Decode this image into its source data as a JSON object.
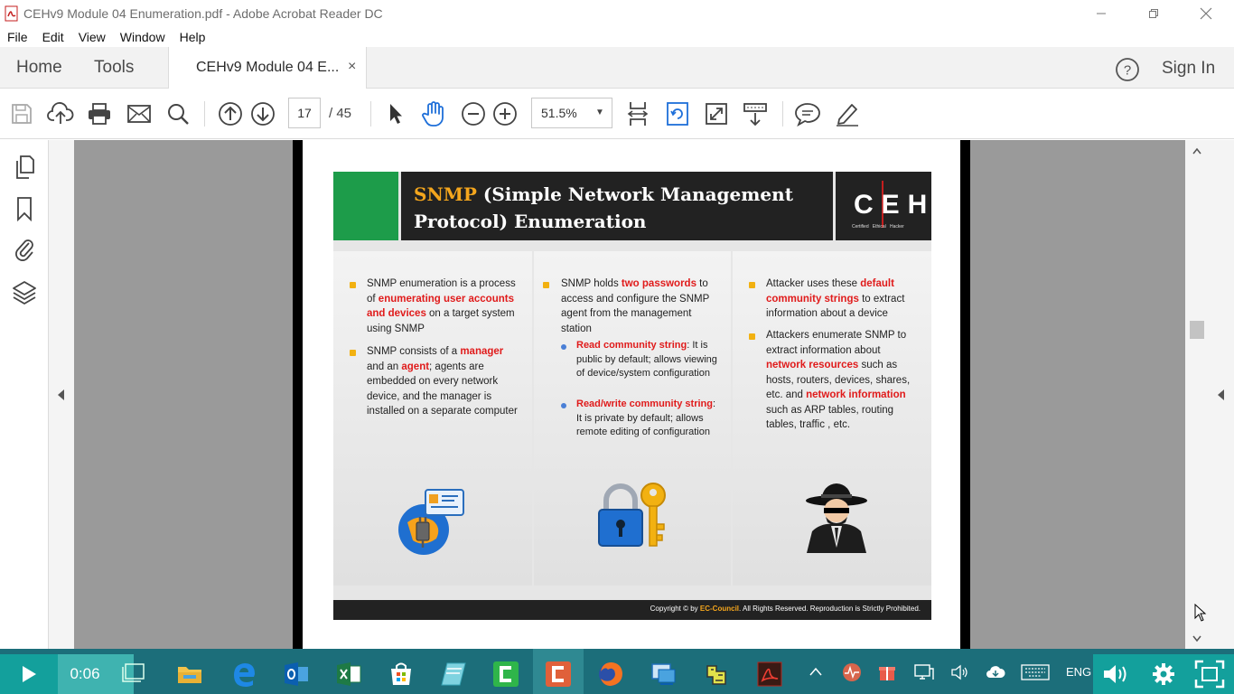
{
  "window": {
    "title": "CEHv9 Module 04 Enumeration.pdf - Adobe Acrobat Reader DC",
    "controls": [
      "minimize",
      "restore",
      "close"
    ]
  },
  "menu": [
    "File",
    "Edit",
    "View",
    "Window",
    "Help"
  ],
  "tabs": {
    "home": "Home",
    "tools": "Tools",
    "document": "CEHv9 Module 04 E...",
    "close": "×",
    "sign_in": "Sign In"
  },
  "toolbar": {
    "page_current": "17",
    "page_total": "/ 45",
    "zoom": "51.5%",
    "zoom_caret": "▼"
  },
  "slide": {
    "title_accent": "SNMP",
    "title_rest": " (Simple Network Management Protocol) Enumeration",
    "logo": "CEH",
    "logo_sub": "Certified   Ethical   Hacker",
    "col1": {
      "b1_pre": "SNMP enumeration is a process of ",
      "b1_red": "enumerating user accounts and devices",
      "b1_post": " on a target system using SNMP",
      "b2_pre": "SNMP consists of a ",
      "b2_red1": "manager",
      "b2_mid": " and an ",
      "b2_red2": "agent",
      "b2_post": "; agents are embedded on every network device, and the manager is installed on a separate computer"
    },
    "col2": {
      "b1_pre": "SNMP holds ",
      "b1_red": "two passwords",
      "b1_post": " to access and configure the SNMP agent from the management station",
      "s1_red": "Read community string",
      "s1_post": ": It is public by default; allows viewing of device/system configuration",
      "s2_red": "Read/write community string",
      "s2_post": ": It is private by default; allows remote editing of configuration"
    },
    "col3": {
      "b1_pre": "Attacker uses these ",
      "b1_red": "default community strings",
      "b1_post": " to extract information about a device",
      "b2_pre": "Attackers enumerate SNMP to extract information about ",
      "b2_red1": "network resources",
      "b2_mid": " such as hosts, routers, devices, shares, etc. and ",
      "b2_red2": "network information",
      "b2_post": " such as ARP tables, routing tables, traffic , etc."
    },
    "footer_pre": "Copyright © by ",
    "footer_org": "EC-Council",
    "footer_post": ". All Rights Reserved. Reproduction is Strictly Prohibited."
  },
  "taskbar": {
    "time": "0:06",
    "lang": "ENG"
  },
  "icons": {
    "left_panel": [
      "pages-icon",
      "bookmark-icon",
      "attachment-icon",
      "layers-icon"
    ],
    "toolbar": [
      "save-icon",
      "upload-icon",
      "print-icon",
      "mail-icon",
      "search-icon",
      "prev-page-icon",
      "next-page-icon",
      "select-cursor-icon",
      "hand-icon",
      "zoom-out-icon",
      "zoom-in-icon",
      "fit-page-icon",
      "rotate-icon",
      "fullscreen-icon",
      "scroll-mode-icon",
      "comment-icon",
      "sign-pen-icon"
    ]
  },
  "colors": {
    "accent_green": "#1d9c4a",
    "title_accent": "#f4a61d",
    "highlight_red": "#e01b1b",
    "taskbar": "#1c6e7a",
    "player_teal": "#13a09c"
  }
}
